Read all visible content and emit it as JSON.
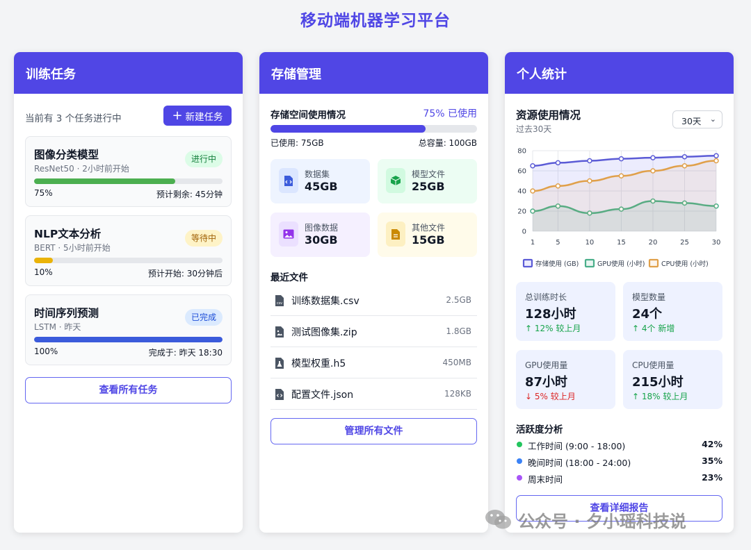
{
  "page": {
    "title": "移动端机器学习平台"
  },
  "training": {
    "header": "训练任务",
    "summary": "当前有 3 个任务进行中",
    "new_task_label": "新建任务",
    "tasks": [
      {
        "name": "图像分类模型",
        "meta": "ResNet50 · 2小时前开始",
        "status": "进行中",
        "progress": 0.75,
        "progress_label": "75%",
        "eta": "预计剩余: 45分钟",
        "bar_color": "#4caf50"
      },
      {
        "name": "NLP文本分析",
        "meta": "BERT · 5小时前开始",
        "status": "等待中",
        "progress": 0.1,
        "progress_label": "10%",
        "eta": "预计开始: 30分钟后",
        "bar_color": "#eab308"
      },
      {
        "name": "时间序列预测",
        "meta": "LSTM · 昨天",
        "status": "已完成",
        "progress": 1.0,
        "progress_label": "100%",
        "eta": "完成于: 昨天 18:30",
        "bar_color": "#3b5bdb"
      }
    ],
    "view_all_label": "查看所有任务"
  },
  "storage": {
    "header": "存储管理",
    "usage_title": "存储空间使用情况",
    "usage_pct_label": "75% 已使用",
    "usage_fraction": 0.75,
    "used_label": "已使用: 75GB",
    "total_label": "总容量: 100GB",
    "types": [
      {
        "label": "数据集",
        "value": "45GB",
        "icon": "dataset-file-icon",
        "bg": "#eef4ff",
        "icon_bg": "#dbe6ff",
        "icon_color": "#3b5bdb"
      },
      {
        "label": "模型文件",
        "value": "25GB",
        "icon": "model-cube-icon",
        "bg": "#ecfdf3",
        "icon_bg": "#d1fae0",
        "icon_color": "#16a34a"
      },
      {
        "label": "图像数据",
        "value": "30GB",
        "icon": "image-icon",
        "bg": "#f5f0ff",
        "icon_bg": "#ebe0ff",
        "icon_color": "#9333ea"
      },
      {
        "label": "其他文件",
        "value": "15GB",
        "icon": "document-icon",
        "bg": "#fffbea",
        "icon_bg": "#fdf0c2",
        "icon_color": "#ca8a04"
      }
    ],
    "recent_title": "最近文件",
    "files": [
      {
        "name": "训练数据集.csv",
        "size": "2.5GB",
        "icon": "csv-file-icon"
      },
      {
        "name": "测试图像集.zip",
        "size": "1.8GB",
        "icon": "image-file-icon"
      },
      {
        "name": "模型权重.h5",
        "size": "450MB",
        "icon": "flask-file-icon"
      },
      {
        "name": "配置文件.json",
        "size": "128KB",
        "icon": "code-file-icon"
      }
    ],
    "manage_label": "管理所有文件"
  },
  "stats": {
    "header": "个人统计",
    "resource_title": "资源使用情况",
    "resource_sub": "过去30天",
    "range_value": "30天",
    "cards": [
      {
        "label": "总训练时长",
        "value": "128小时",
        "trend": "↑ 12% 较上月",
        "direction": "up"
      },
      {
        "label": "模型数量",
        "value": "24个",
        "trend": "↑ 4个 新增",
        "direction": "up"
      },
      {
        "label": "GPU使用量",
        "value": "87小时",
        "trend": "↓ 5% 较上月",
        "direction": "down"
      },
      {
        "label": "CPU使用量",
        "value": "215小时",
        "trend": "↑ 18% 较上月",
        "direction": "up"
      }
    ],
    "activity_title": "活跃度分析",
    "activity": [
      {
        "label": "工作时间 (9:00 - 18:00)",
        "pct": "42%",
        "color": "#22c55e"
      },
      {
        "label": "晚间时间 (18:00 - 24:00)",
        "pct": "35%",
        "color": "#3b82f6"
      },
      {
        "label": "周末时间",
        "pct": "23%",
        "color": "#a855f7"
      }
    ],
    "report_label": "查看详细报告"
  },
  "chart_data": {
    "type": "line",
    "x": [
      1,
      5,
      10,
      15,
      20,
      25,
      30
    ],
    "ylim": [
      0,
      80
    ],
    "yticks": [
      0,
      20,
      40,
      60,
      80
    ],
    "xticks": [
      "1",
      "5",
      "10",
      "15",
      "20",
      "25",
      "30"
    ],
    "grid": true,
    "legend_position": "bottom",
    "series": [
      {
        "name": "存储使用 (GB)",
        "values": [
          65,
          68,
          70,
          72,
          73,
          74,
          75
        ],
        "color": "#5b5bd6",
        "fill": "rgba(99,102,241,0.12)"
      },
      {
        "name": "GPU使用 (小时)",
        "values": [
          20,
          25,
          18,
          22,
          30,
          28,
          25
        ],
        "color": "#4aae8a",
        "fill": "rgba(74,174,138,0.12)"
      },
      {
        "name": "CPU使用 (小时)",
        "values": [
          40,
          45,
          50,
          55,
          60,
          65,
          70
        ],
        "color": "#e0a04a",
        "fill": "rgba(224,160,74,0.10)"
      }
    ]
  },
  "watermark": {
    "text": "公众号 · 夕小瑶科技说",
    "icon": "wechat-icon"
  }
}
